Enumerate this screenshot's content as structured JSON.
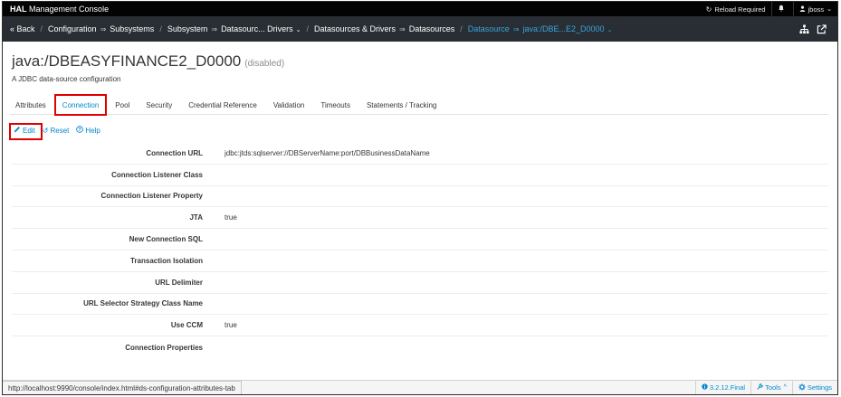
{
  "topbar": {
    "brand_bold": "HAL",
    "brand_rest": "Management Console",
    "reload": "Reload Required",
    "user": "jboss"
  },
  "breadcrumb": {
    "back": "« Back",
    "item1a": "Configuration",
    "item1b": "Subsystems",
    "item2a": "Subsystem",
    "item2b": "Datasourc... Drivers",
    "item3a": "Datasources & Drivers",
    "item3b": "Datasources",
    "item4a": "Datasource",
    "item4b": "java:/DBE...E2_D0000"
  },
  "header": {
    "title": "java:/DBEASYFINANCE2_D0000",
    "state": "(disabled)",
    "subtitle": "A JDBC data-source configuration"
  },
  "tabs": [
    {
      "label": "Attributes"
    },
    {
      "label": "Connection"
    },
    {
      "label": "Pool"
    },
    {
      "label": "Security"
    },
    {
      "label": "Credential Reference"
    },
    {
      "label": "Validation"
    },
    {
      "label": "Timeouts"
    },
    {
      "label": "Statements / Tracking"
    }
  ],
  "actions": {
    "edit": "Edit",
    "reset": "Reset",
    "help": "Help"
  },
  "attributes": [
    {
      "label": "Connection URL",
      "value": "jdbc:jtds:sqlserver://DBServerName:port/DBBusinessDataName"
    },
    {
      "label": "Connection Listener Class",
      "value": ""
    },
    {
      "label": "Connection Listener Property",
      "value": ""
    },
    {
      "label": "JTA",
      "value": "true"
    },
    {
      "label": "New Connection SQL",
      "value": ""
    },
    {
      "label": "Transaction Isolation",
      "value": ""
    },
    {
      "label": "URL Delimiter",
      "value": ""
    },
    {
      "label": "URL Selector Strategy Class Name",
      "value": ""
    },
    {
      "label": "Use CCM",
      "value": "true"
    },
    {
      "label": "Connection Properties",
      "value": ""
    }
  ],
  "footer": {
    "status_url": "http://localhost:9990/console/index.html#ds-configuration-attributes-tab",
    "version": "3.2.12.Final",
    "tools": "Tools",
    "settings": "Settings"
  },
  "colors": {
    "accent": "#0088ce",
    "nav_active": "#39a5dc",
    "highlight": "#e00000"
  }
}
